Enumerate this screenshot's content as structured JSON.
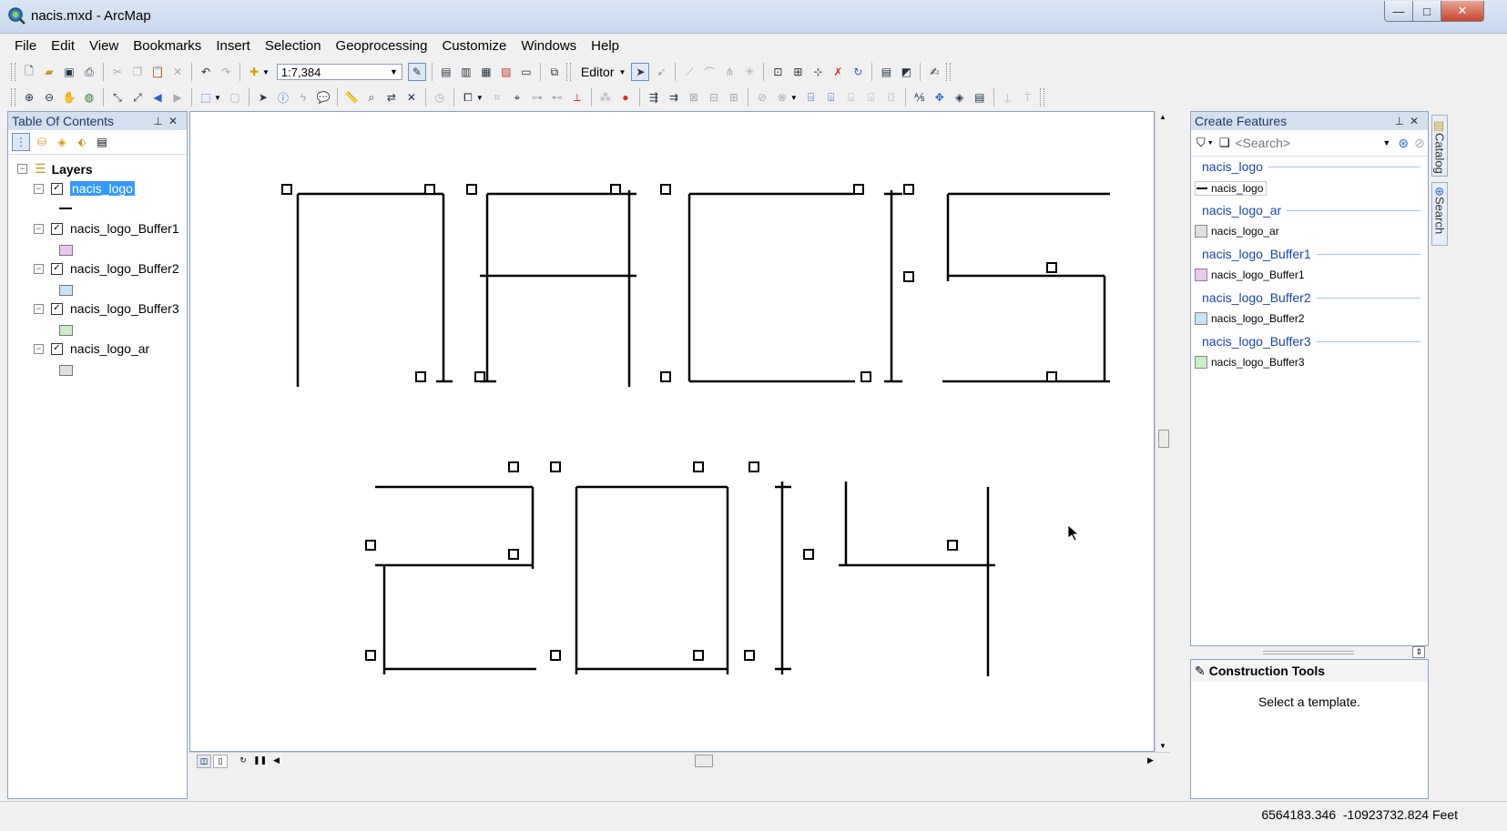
{
  "window": {
    "title": "nacis.mxd - ArcMap",
    "min": "—",
    "max": "□",
    "close": "✕"
  },
  "menu": [
    "File",
    "Edit",
    "View",
    "Bookmarks",
    "Insert",
    "Selection",
    "Geoprocessing",
    "Customize",
    "Windows",
    "Help"
  ],
  "toolbar": {
    "scale": "1:7,384",
    "editor_label": "Editor"
  },
  "toc": {
    "title": "Table Of Contents",
    "root": "Layers",
    "layers": [
      {
        "name": "nacis_logo",
        "checked": true,
        "symbol": "line",
        "color": "#000000",
        "selected": true
      },
      {
        "name": "nacis_logo_Buffer1",
        "checked": true,
        "symbol": "fill",
        "color": "#e8c8ee"
      },
      {
        "name": "nacis_logo_Buffer2",
        "checked": true,
        "symbol": "fill",
        "color": "#c8e2f4"
      },
      {
        "name": "nacis_logo_Buffer3",
        "checked": true,
        "symbol": "fill",
        "color": "#cceccc"
      },
      {
        "name": "nacis_logo_ar",
        "checked": true,
        "symbol": "fill",
        "color": "#e0e0e0"
      }
    ]
  },
  "create_features": {
    "title": "Create Features",
    "search_placeholder": "<Search>",
    "groups": [
      {
        "header": "nacis_logo",
        "item": "nacis_logo",
        "symbol": "line",
        "color": "#000000"
      },
      {
        "header": "nacis_logo_ar",
        "item": "nacis_logo_ar",
        "symbol": "fill",
        "color": "#e0e0e0"
      },
      {
        "header": "nacis_logo_Buffer1",
        "item": "nacis_logo_Buffer1",
        "symbol": "fill",
        "color": "#e8c8ee"
      },
      {
        "header": "nacis_logo_Buffer2",
        "item": "nacis_logo_Buffer2",
        "symbol": "fill",
        "color": "#c8e2f4"
      },
      {
        "header": "nacis_logo_Buffer3",
        "item": "nacis_logo_Buffer3",
        "symbol": "fill",
        "color": "#cceccc"
      }
    ]
  },
  "construction_tools": {
    "title": "Construction Tools",
    "message": "Select a template."
  },
  "side_tabs": [
    "Catalog",
    "Search"
  ],
  "status": {
    "coordinates": "6564183.346  -10923732.824 Feet"
  },
  "colors": {
    "accent": "#3399ff",
    "panel_title": "#1e3a6b",
    "group_header": "#1a47b0"
  }
}
